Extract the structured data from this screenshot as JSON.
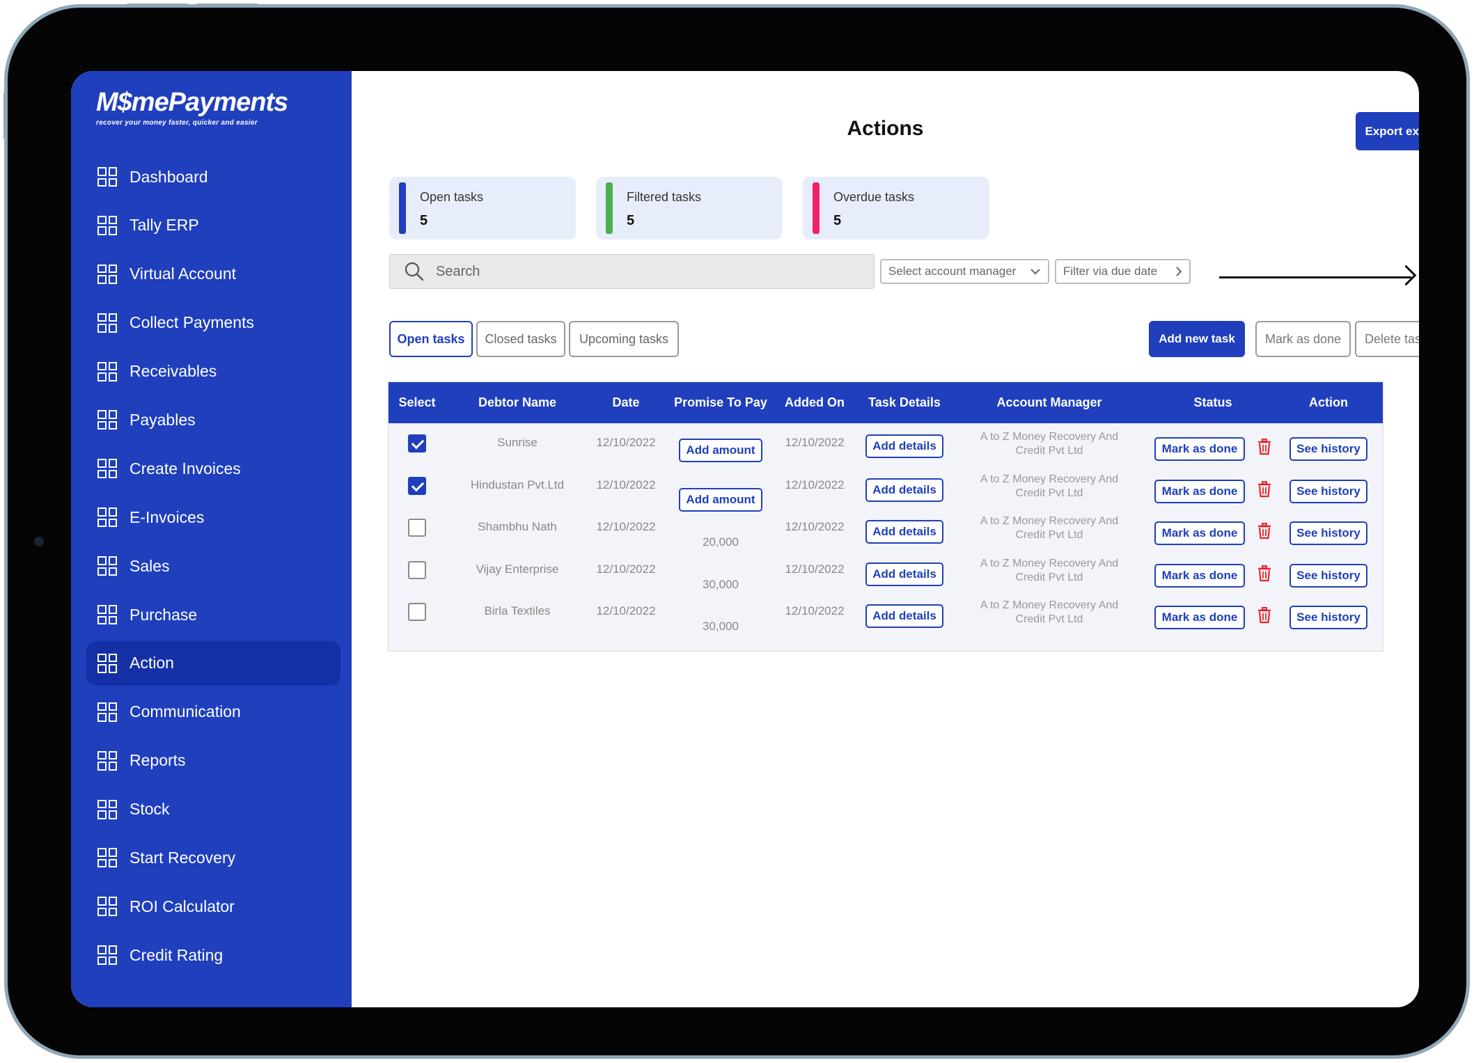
{
  "brand": {
    "name": "M$mePayments",
    "tagline": "recover your money faster, quicker and easier"
  },
  "sidebar": {
    "items": [
      {
        "label": "Dashboard",
        "active": false
      },
      {
        "label": "Tally ERP",
        "active": false
      },
      {
        "label": "Virtual Account",
        "active": false
      },
      {
        "label": "Collect Payments",
        "active": false
      },
      {
        "label": "Receivables",
        "active": false
      },
      {
        "label": "Payables",
        "active": false
      },
      {
        "label": "Create Invoices",
        "active": false
      },
      {
        "label": "E-Invoices",
        "active": false
      },
      {
        "label": "Sales",
        "active": false
      },
      {
        "label": "Purchase",
        "active": false
      },
      {
        "label": "Action",
        "active": true
      },
      {
        "label": "Communication",
        "active": false
      },
      {
        "label": "Reports",
        "active": false
      },
      {
        "label": "Stock",
        "active": false
      },
      {
        "label": "Start Recovery",
        "active": false
      },
      {
        "label": "ROI Calculator",
        "active": false
      },
      {
        "label": "Credit Rating",
        "active": false
      }
    ],
    "icon": "dashboard-grid-icon"
  },
  "header": {
    "title": "Actions",
    "export_label": "Export excel"
  },
  "stats": [
    {
      "label": "Open tasks",
      "value": "5",
      "color": "#1f3fbd"
    },
    {
      "label": "Filtered tasks",
      "value": "5",
      "color": "#4caf50"
    },
    {
      "label": "Overdue tasks",
      "value": "5",
      "color": "#f0226a"
    }
  ],
  "filters": {
    "search_placeholder": "Search",
    "account_manager": "Select account manager",
    "due_date": "Filter via due date"
  },
  "tabs": [
    "Open tasks",
    "Closed tasks",
    "Upcoming tasks"
  ],
  "actions": {
    "add": "Add new task",
    "mark": "Mark as done",
    "delete": "Delete tasks"
  },
  "table": {
    "headers": [
      "Select",
      "Debtor Name",
      "Date",
      "Promise To Pay",
      "Added On",
      "Task Details",
      "Account Manager",
      "Status",
      "Action"
    ],
    "rows": [
      {
        "checked": true,
        "debtor": "Sunrise",
        "date": "12/10/2022",
        "promise": "Add amount",
        "promise_is_button": true,
        "added": "12/10/2022",
        "details": "Add details",
        "manager_line1": "A to Z Money Recovery And",
        "manager_line2": "Credit Pvt Ltd",
        "status": "Mark as done",
        "action": "See history"
      },
      {
        "checked": true,
        "debtor": "Hindustan Pvt.Ltd",
        "date": "12/10/2022",
        "promise": "Add amount",
        "promise_is_button": true,
        "added": "12/10/2022",
        "details": "Add details",
        "manager_line1": "A to Z Money Recovery And",
        "manager_line2": "Credit Pvt Ltd",
        "status": "Mark as done",
        "action": "See history"
      },
      {
        "checked": false,
        "debtor": "Shambhu Nath",
        "date": "12/10/2022",
        "promise": "20,000",
        "promise_is_button": false,
        "added": "12/10/2022",
        "details": "Add details",
        "manager_line1": "A to Z Money Recovery And",
        "manager_line2": "Credit Pvt Ltd",
        "status": "Mark as done",
        "action": "See history"
      },
      {
        "checked": false,
        "debtor": "Vijay Enterprise",
        "date": "12/10/2022",
        "promise": "30,000",
        "promise_is_button": false,
        "added": "12/10/2022",
        "details": "Add details",
        "manager_line1": "A to Z Money Recovery And",
        "manager_line2": "Credit Pvt Ltd",
        "status": "Mark as done",
        "action": "See history"
      },
      {
        "checked": false,
        "debtor": "Birla Textiles",
        "date": "12/10/2022",
        "promise": "30,000",
        "promise_is_button": false,
        "added": "12/10/2022",
        "details": "Add details",
        "manager_line1": "A to Z Money Recovery And",
        "manager_line2": "Credit Pvt Ltd",
        "status": "Mark as done",
        "action": "See history"
      }
    ]
  }
}
